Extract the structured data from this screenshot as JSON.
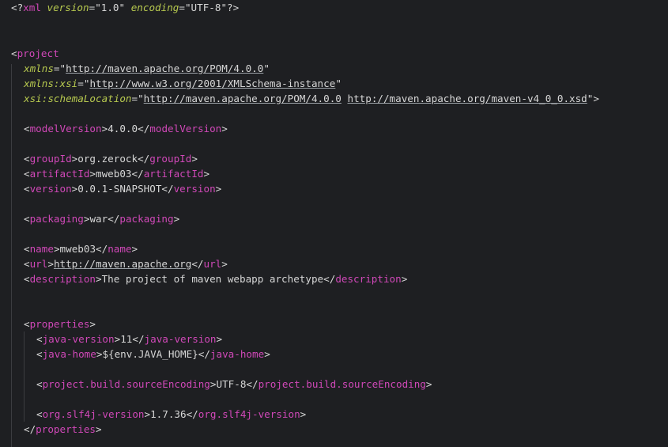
{
  "lines": {
    "l1": {
      "lt": "<?",
      "name": "xml",
      "a1": "version",
      "v1": "\"1.0\"",
      "a2": "encoding",
      "v2": "\"UTF-8\"",
      "end": "?>"
    },
    "project_open": {
      "lt": "<",
      "name": "project"
    },
    "xmlns": {
      "attr": "xmlns",
      "eq": "=",
      "q1": "\"",
      "url": "http://maven.apache.org/POM/4.0.0",
      "q2": "\""
    },
    "xmlns_xsi": {
      "attr": "xmlns:xsi",
      "eq": "=",
      "q1": "\"",
      "url": "http://www.w3.org/2001/XMLSchema-instance",
      "q2": "\""
    },
    "schema": {
      "attr": "xsi:schemaLocation",
      "eq": "=",
      "q1": "\"",
      "url1": "http://maven.apache.org/POM/4.0.0",
      "sp": " ",
      "url2": "http://maven.apache.org/maven-v4_0_0.xsd",
      "q2": "\"",
      "gt": ">"
    },
    "modelVersion": {
      "tag": "modelVersion",
      "value": "4.0.0"
    },
    "groupId": {
      "tag": "groupId",
      "value": "org.zerock"
    },
    "artifactId": {
      "tag": "artifactId",
      "value": "mweb03"
    },
    "version": {
      "tag": "version",
      "value": "0.0.1-SNAPSHOT"
    },
    "packaging": {
      "tag": "packaging",
      "value": "war"
    },
    "name": {
      "tag": "name",
      "value": "mweb03"
    },
    "url": {
      "tag": "url",
      "value": "http://maven.apache.org"
    },
    "description": {
      "tag": "description",
      "value": "The project of maven webapp archetype"
    },
    "properties_open": {
      "tag": "properties"
    },
    "java_version": {
      "tag": "java-version",
      "value": "11"
    },
    "java_home": {
      "tag": "java-home",
      "value": "${env.JAVA_HOME}"
    },
    "source_encoding": {
      "tag": "project.build.sourceEncoding",
      "value": "UTF-8"
    },
    "slf4j": {
      "tag": "org.slf4j-version",
      "value": "1.7.36"
    },
    "properties_close": {
      "tag": "properties"
    }
  }
}
